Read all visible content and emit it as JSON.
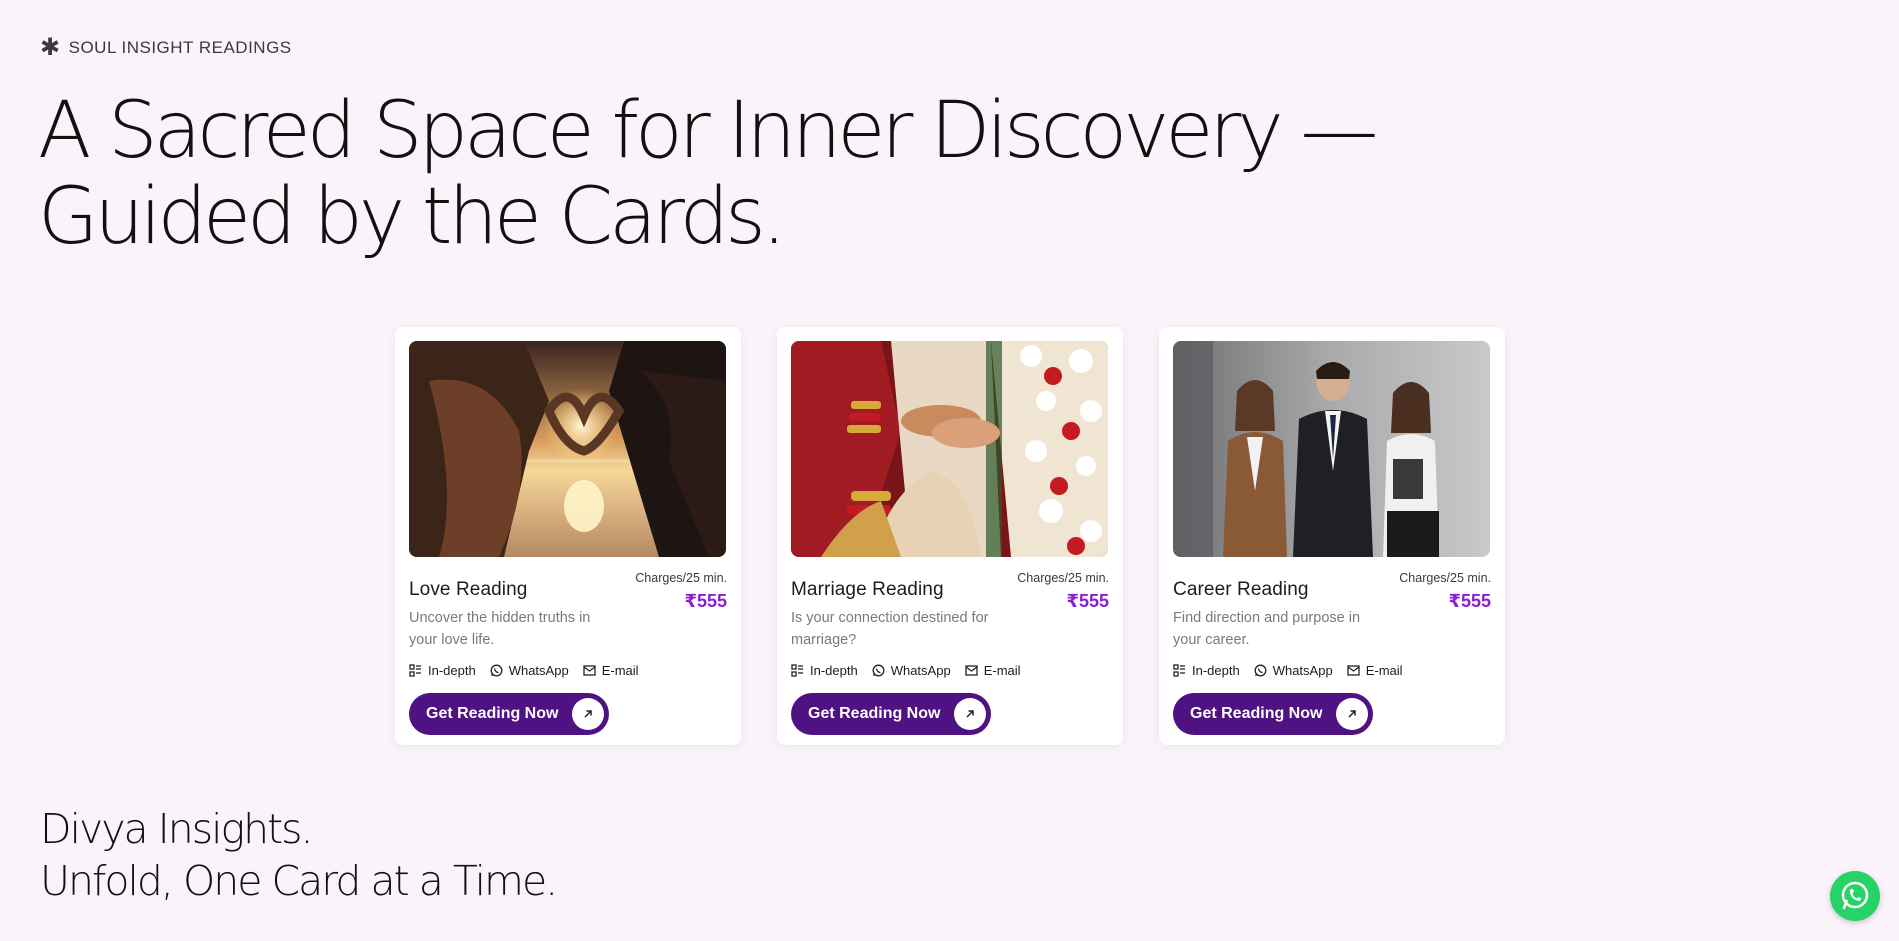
{
  "brand": {
    "eyebrow": "SOUL INSIGHT READINGS",
    "icon": "asterisk-icon"
  },
  "hero": {
    "title_line1": "A Sacred Space for Inner Discovery —",
    "title_line2": "Guided by the Cards."
  },
  "cards": [
    {
      "title": "Love Reading",
      "description": "Uncover the hidden truths in your love life.",
      "charges_label": "Charges/25 min.",
      "price": "₹555",
      "image": "couple-heart-sunset-image",
      "features": [
        "In-depth",
        "WhatsApp",
        "E-mail"
      ],
      "cta": "Get Reading Now"
    },
    {
      "title": "Marriage Reading",
      "description": "Is your connection destined for marriage?",
      "charges_label": "Charges/25 min.",
      "price": "₹555",
      "image": "wedding-hands-image",
      "features": [
        "In-depth",
        "WhatsApp",
        "E-mail"
      ],
      "cta": "Get Reading Now"
    },
    {
      "title": "Career Reading",
      "description": "Find direction and purpose in your career.",
      "charges_label": "Charges/25 min.",
      "price": "₹555",
      "image": "business-team-image",
      "features": [
        "In-depth",
        "WhatsApp",
        "E-mail"
      ],
      "cta": "Get Reading Now"
    }
  ],
  "footer": {
    "line1": "Divya Insights.",
    "line2": "Unfold, One Card at a Time."
  },
  "colors": {
    "background": "#faf4fa",
    "accent_purple": "#4f1283",
    "price_purple": "#8a1fd4",
    "whatsapp_green": "#25d366"
  },
  "icons": {
    "feature_indepth": "list-grid-icon",
    "feature_whatsapp": "whatsapp-icon",
    "feature_email": "mail-icon",
    "cta_arrow": "arrow-up-right-icon",
    "fab": "whatsapp-icon"
  }
}
